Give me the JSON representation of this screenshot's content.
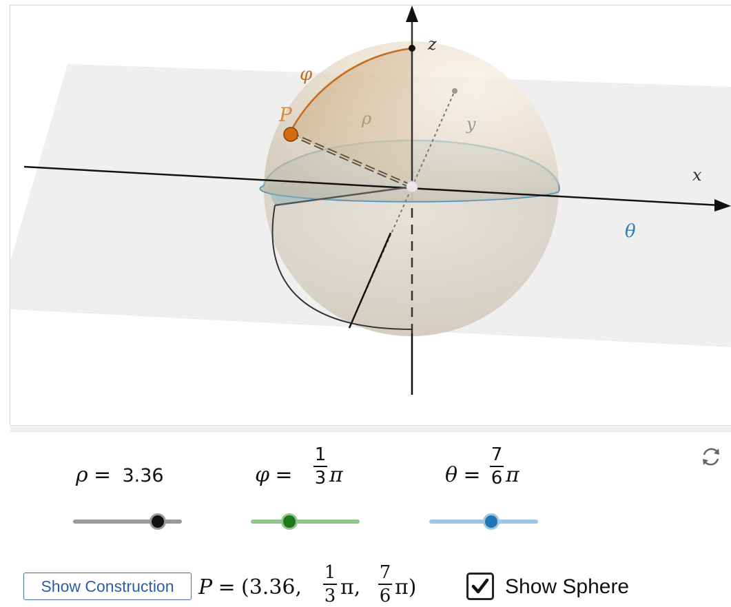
{
  "scene": {
    "axis_x": "x",
    "axis_y": "y",
    "axis_z": "z",
    "label_point": "P",
    "label_rho": "ρ",
    "label_phi": "φ",
    "label_theta": "θ"
  },
  "controls": {
    "rho": {
      "symbol": "ρ",
      "equals": "=",
      "value": "3.36",
      "slider_fraction": 0.83,
      "color": "#9a9a9a",
      "knob_color": "#111111"
    },
    "phi": {
      "symbol": "φ",
      "equals": "=",
      "numerator": "1",
      "denominator": "3",
      "pi": "π",
      "slider_fraction": 0.33,
      "color": "#93c48e",
      "knob_color": "#1a7a1a"
    },
    "theta": {
      "symbol": "θ",
      "equals": "=",
      "numerator": "7",
      "denominator": "6",
      "pi": "π",
      "slider_fraction": 0.58,
      "color": "#9fc7e4",
      "knob_color": "#1f76b4"
    }
  },
  "point_readout": {
    "lhs": "P",
    "equals": "=",
    "open": "(3.36,",
    "phi_num": "1",
    "phi_den": "3",
    "pi1": "π,",
    "theta_num": "7",
    "theta_den": "6",
    "pi2": "π)"
  },
  "buttons": {
    "show_construction": "Show Construction"
  },
  "checkboxes": {
    "show_sphere": {
      "label": "Show Sphere",
      "checked": true
    }
  },
  "icons": {
    "reset": "refresh-icon",
    "checkmark": "checkmark-icon"
  }
}
